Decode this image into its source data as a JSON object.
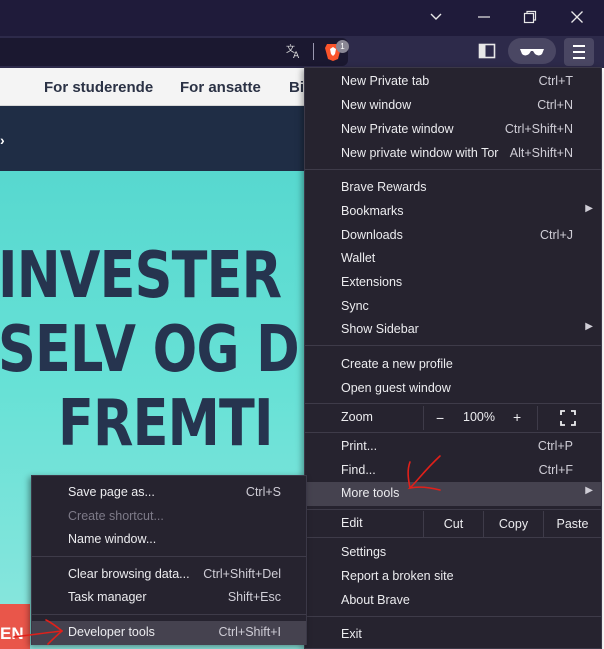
{
  "window": {
    "controls": {
      "tab_search": "tab-search",
      "minimize": "minimize",
      "maximize": "restore",
      "close": "close"
    }
  },
  "toolbar": {
    "shields_count": "1"
  },
  "site": {
    "nav": [
      "For studerende",
      "For ansatte",
      "Bi"
    ],
    "hero_lines": [
      "INVESTER",
      "SELV OG D",
      "FREMTI"
    ],
    "hero_button": "EN"
  },
  "menu": {
    "group1": [
      {
        "label": "New Private tab",
        "shortcut": "Ctrl+T"
      },
      {
        "label": "New window",
        "shortcut": "Ctrl+N"
      },
      {
        "label": "New Private window",
        "shortcut": "Ctrl+Shift+N"
      },
      {
        "label": "New private window with Tor",
        "shortcut": "Alt+Shift+N"
      }
    ],
    "group2": [
      {
        "label": "Brave Rewards",
        "shortcut": ""
      },
      {
        "label": "Bookmarks",
        "shortcut": ""
      },
      {
        "label": "Downloads",
        "shortcut": "Ctrl+J"
      },
      {
        "label": "Wallet",
        "shortcut": ""
      },
      {
        "label": "Extensions",
        "shortcut": ""
      },
      {
        "label": "Sync",
        "shortcut": ""
      },
      {
        "label": "Show Sidebar",
        "shortcut": ""
      }
    ],
    "group3": [
      {
        "label": "Create a new profile"
      },
      {
        "label": "Open guest window"
      }
    ],
    "zoom": {
      "label": "Zoom",
      "minus": "−",
      "value": "100%",
      "plus": "+"
    },
    "group4": [
      {
        "label": "Print...",
        "shortcut": "Ctrl+P"
      },
      {
        "label": "Find...",
        "shortcut": "Ctrl+F"
      },
      {
        "label": "More tools",
        "shortcut": ""
      }
    ],
    "edit": {
      "label": "Edit",
      "cut": "Cut",
      "copy": "Copy",
      "paste": "Paste"
    },
    "group5": [
      {
        "label": "Settings"
      },
      {
        "label": "Report a broken site"
      },
      {
        "label": "About Brave"
      }
    ],
    "exit": "Exit"
  },
  "submenu": {
    "items": [
      {
        "label": "Save page as...",
        "shortcut": "Ctrl+S"
      },
      {
        "label": "Create shortcut...",
        "shortcut": ""
      },
      {
        "label": "Name window...",
        "shortcut": ""
      },
      {
        "label": "Clear browsing data...",
        "shortcut": "Ctrl+Shift+Del"
      },
      {
        "label": "Task manager",
        "shortcut": "Shift+Esc"
      },
      {
        "label": "Developer tools",
        "shortcut": "Ctrl+Shift+I"
      }
    ]
  },
  "colors": {
    "menu_bg": "#26232f",
    "menu_highlight": "#45424f",
    "titlebar": "#1f1b3a",
    "hero_teal": "#5ddad1",
    "annotation_red": "#e0201a"
  }
}
